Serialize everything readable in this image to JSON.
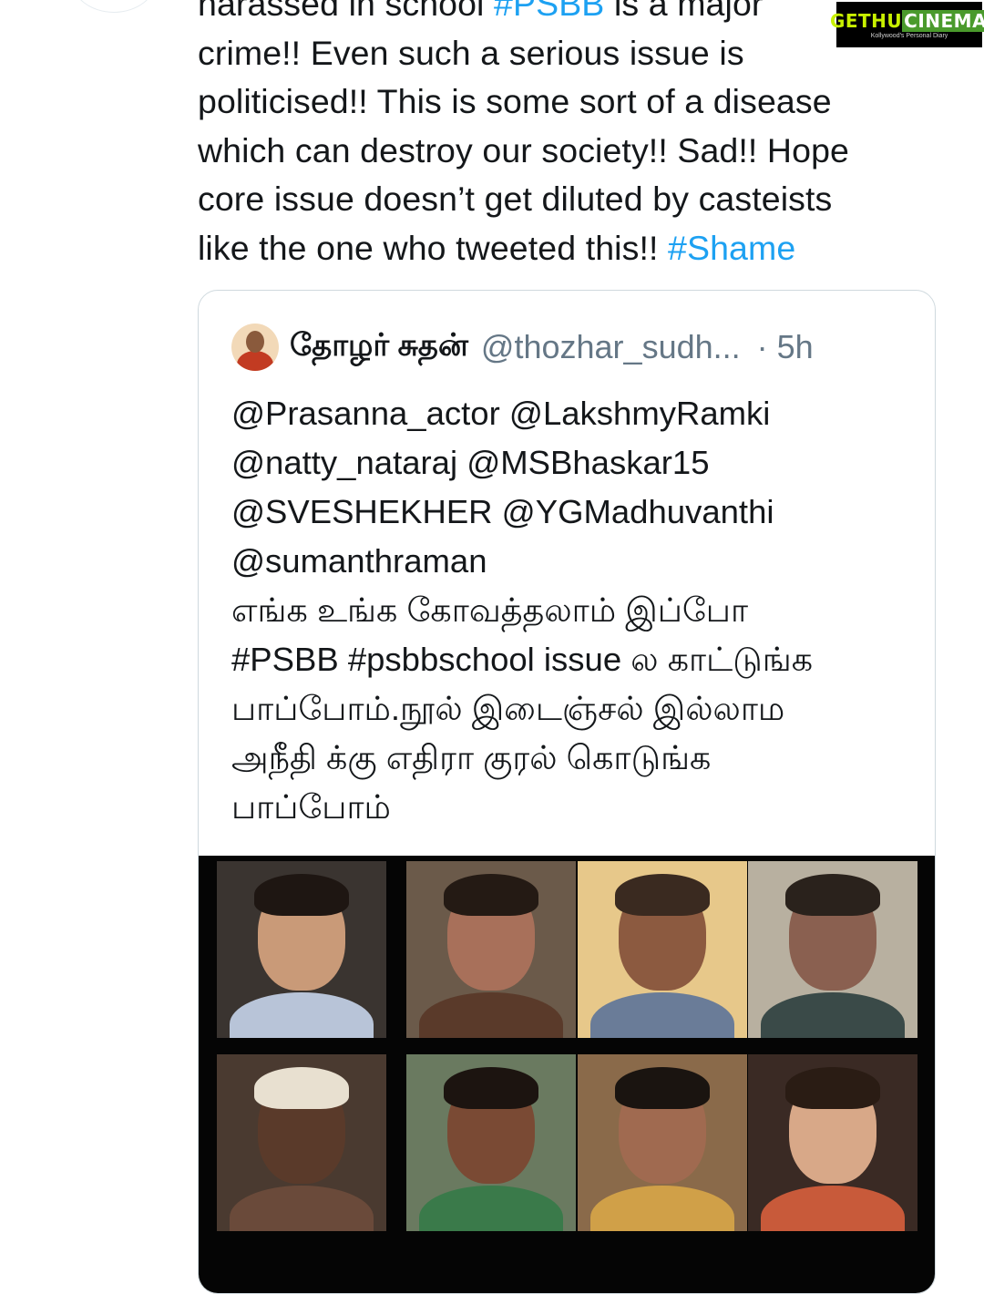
{
  "tweet": {
    "lines": [
      {
        "text": "harassed in school ",
        "hashtag": "#PSBB",
        "after": " is a major"
      },
      {
        "text": "crime!! Even such a serious issue is"
      },
      {
        "text": "politicised!! This is some sort of a disease"
      },
      {
        "text": "which can destroy our society!! Sad!! Hope"
      },
      {
        "text": "core issue doesn’t get diluted by casteists"
      },
      {
        "text": "like the one who tweeted this!! ",
        "hashtag": "#Shame"
      }
    ]
  },
  "quote": {
    "name": "தோழர் சுதன்",
    "handle": "@thozhar_sudh...",
    "time": "· 5h",
    "lines": [
      "@Prasanna_actor @LakshmyRamki",
      "@natty_nataraj @MSBhaskar15",
      "@SVESHEKHER @YGMadhuvanthi",
      "@sumanthraman",
      "எங்க உங்க கோவத்தலாம் இப்போ",
      "#PSBB #psbbschool  issue ல காட்டுங்க",
      "பாப்போம்.நூல் இடைஞ்சல் இல்லாம",
      "அநீதி க்கு எதிரா குரல் கொடுங்க",
      "பாப்போம்"
    ]
  },
  "media": {
    "tiles": [
      {
        "bg": "#3a3430",
        "skin": "#c99a78",
        "hair": "#1e1612",
        "shirt": "#b8c4d8"
      },
      {
        "bg": "#6b5a4a",
        "skin": "#a8705a",
        "hair": "#241a14",
        "shirt": "#5a3a2a"
      },
      {
        "bg": "#e7c88a",
        "skin": "#8c5a40",
        "hair": "#3a2a20",
        "shirt": "#6a7c98"
      },
      {
        "bg": "#b8b0a0",
        "skin": "#8a6050",
        "hair": "#2a221c",
        "shirt": "#3a4a48"
      },
      {
        "bg": "#4a3a30",
        "skin": "#5a3a2a",
        "hair": "#e8e0d0",
        "shirt": "#6a4a3a"
      },
      {
        "bg": "#6a7a60",
        "skin": "#7a4a34",
        "hair": "#1c1410",
        "shirt": "#3a7a4a"
      },
      {
        "bg": "#8a6a4a",
        "skin": "#a06a50",
        "hair": "#1a1410",
        "shirt": "#d0a048"
      },
      {
        "bg": "#3a2a24",
        "skin": "#d8a888",
        "hair": "#2a1c14",
        "shirt": "#c85a3a"
      }
    ]
  },
  "watermark": {
    "brand_a": "GETHU",
    "brand_b": "CINEMA",
    "tagline": "Kollywood's Personal Diary"
  }
}
